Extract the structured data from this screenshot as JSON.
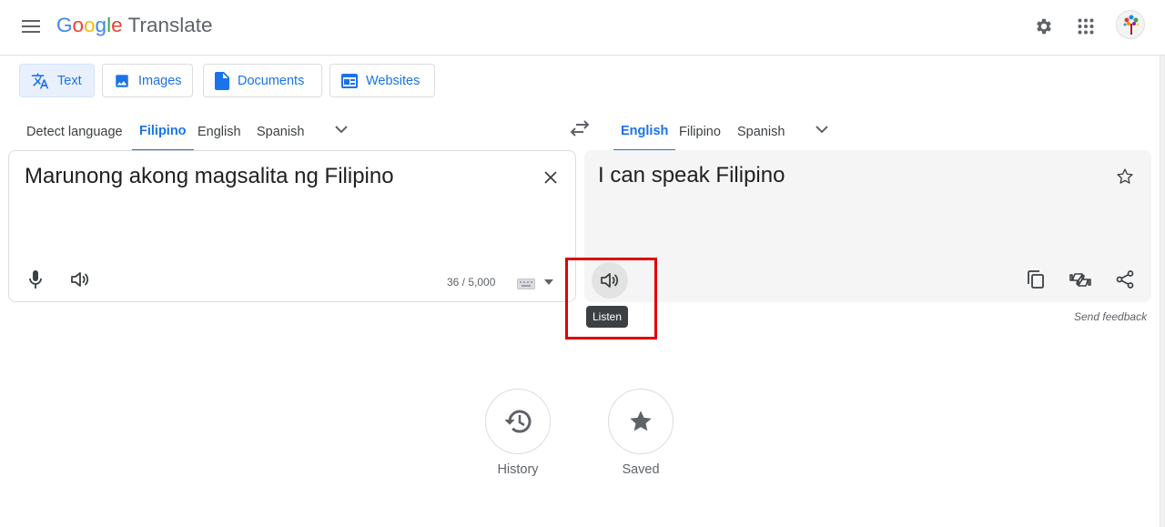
{
  "header": {
    "logo_letters": [
      "G",
      "o",
      "o",
      "g",
      "l",
      "e"
    ],
    "logo_colors": [
      "#4285f4",
      "#ea4335",
      "#fbbc04",
      "#4285f4",
      "#34a853",
      "#ea4335"
    ],
    "product_name": "Translate",
    "icons": [
      "menu-icon",
      "settings-icon",
      "apps-grid-icon",
      "avatar"
    ]
  },
  "mode_tabs": [
    {
      "label": "Text",
      "icon": "translate-icon",
      "active": true
    },
    {
      "label": "Images",
      "icon": "image-icon",
      "active": false
    },
    {
      "label": "Documents",
      "icon": "document-icon",
      "active": false
    },
    {
      "label": "Websites",
      "icon": "website-icon",
      "active": false
    }
  ],
  "source_langs": [
    {
      "label": "Detect language",
      "active": false
    },
    {
      "label": "Filipino",
      "active": true
    },
    {
      "label": "English",
      "active": false
    },
    {
      "label": "Spanish",
      "active": false
    }
  ],
  "target_langs": [
    {
      "label": "English",
      "active": true
    },
    {
      "label": "Filipino",
      "active": false
    },
    {
      "label": "Spanish",
      "active": false
    }
  ],
  "source": {
    "text": "Marunong akong magsalita ng Filipino",
    "char_count": "36 / 5,000"
  },
  "target": {
    "text": "I can speak Filipino"
  },
  "listen_tooltip": "Listen",
  "feedback_label": "Send feedback",
  "bottom": {
    "history_label": "History",
    "saved_label": "Saved"
  },
  "colors": {
    "accent": "#1a73e8",
    "highlight": "#e00000",
    "icon_gray": "#5f6368"
  }
}
